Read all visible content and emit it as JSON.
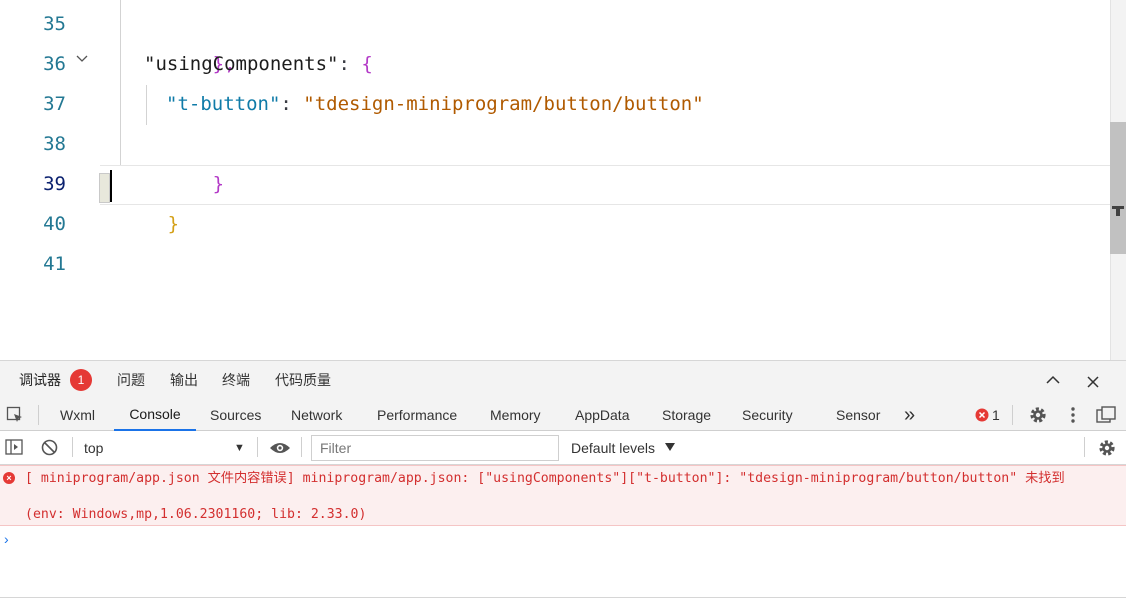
{
  "editor": {
    "lines": [
      {
        "num": "35",
        "parts": [
          "},"
        ]
      },
      {
        "num": "36",
        "parts": [
          "\"usingComponents\"",
          ": ",
          "{"
        ]
      },
      {
        "num": "37",
        "parts": [
          "\"t-button\"",
          ": ",
          "\"tdesign-miniprogram/button/button\""
        ]
      },
      {
        "num": "38",
        "parts": [
          "}"
        ]
      },
      {
        "num": "39",
        "parts": [
          "}"
        ]
      },
      {
        "num": "40",
        "parts": []
      },
      {
        "num": "41",
        "parts": []
      }
    ],
    "active_line": "39"
  },
  "devtools": {
    "top_tabs": {
      "debugger": "调试器",
      "issues": "问题",
      "output": "输出",
      "terminal": "终端",
      "code_quality": "代码质量"
    },
    "error_badge_count": "1",
    "panel_tabs": {
      "wxml": "Wxml",
      "console": "Console",
      "sources": "Sources",
      "network": "Network",
      "performance": "Performance",
      "memory": "Memory",
      "appdata": "AppData",
      "storage": "Storage",
      "security": "Security",
      "sensor": "Sensor"
    },
    "more_tabs": "»",
    "error_count": "1",
    "toolbar": {
      "context": "top",
      "filter_placeholder": "Filter",
      "levels": "Default levels"
    },
    "console": {
      "error_message": "[ miniprogram/app.json 文件内容错误] miniprogram/app.json: [\"usingComponents\"][\"t-button\"]: \"tdesign-miniprogram/button/button\" 未找到",
      "error_env": "(env: Windows,mp,1.06.2301160; lib: 2.33.0)",
      "prompt": "›"
    }
  },
  "colors": {
    "accent": "#1a73e8",
    "error": "#d32f2f",
    "error_bg": "#fcefef",
    "line_number": "#237893"
  }
}
